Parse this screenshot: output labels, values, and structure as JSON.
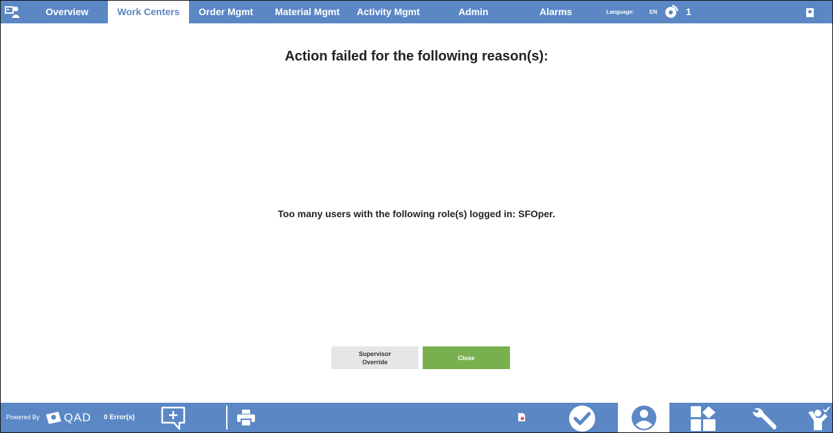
{
  "nav": {
    "tabs": [
      {
        "label": "Overview"
      },
      {
        "label": "Work Centers"
      },
      {
        "label": "Order Mgmt"
      },
      {
        "label": "Material Mgmt"
      },
      {
        "label": "Activity Mgmt"
      },
      {
        "label": "Admin"
      },
      {
        "label": "Alarms"
      }
    ],
    "active_tab": "Work Centers",
    "language_label": "Language:",
    "language_value": "EN",
    "user_count": "1",
    "brand": "QAD"
  },
  "dialog": {
    "title": "Action failed for the following reason(s):",
    "reason": "Too many users with the following role(s) logged in: SFOper.",
    "override_line1": "Supervisor",
    "override_line2": "Override",
    "close_label": "Close"
  },
  "footer": {
    "powered_by": "Powered By",
    "brand": "QAD",
    "errors": "0 Error(s)"
  },
  "colors": {
    "bar": "#5b87c5",
    "close_button": "#78b04f",
    "override_button": "#e6e6e6"
  }
}
